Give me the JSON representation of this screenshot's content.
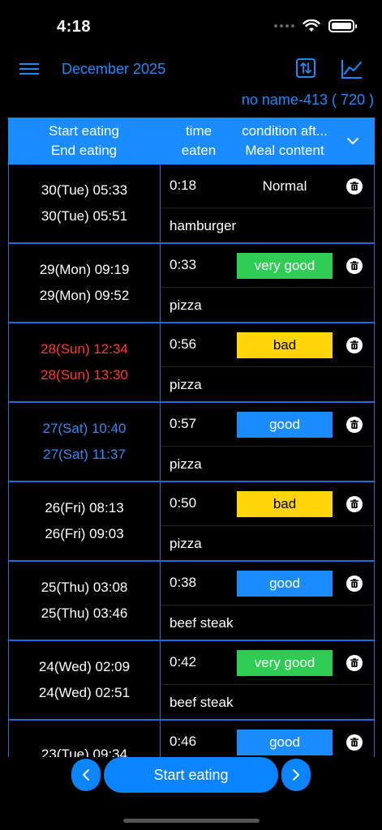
{
  "status": {
    "time": "4:18"
  },
  "nav": {
    "month": "December 2025"
  },
  "user": {
    "label": "no name-413  ( 720 )"
  },
  "header": {
    "start_eating": "Start eating",
    "end_eating": "End eating",
    "time": "time",
    "eaten": "eaten",
    "condition": "condition aft...",
    "meal_content": "Meal content"
  },
  "rows": [
    {
      "start": "30(Tue) 05:33",
      "end": "30(Tue) 05:51",
      "duration": "0:18",
      "condition": "Normal",
      "meal": "hamburger",
      "day_type": "weekday",
      "cond_type": "normal"
    },
    {
      "start": "29(Mon) 09:19",
      "end": "29(Mon) 09:52",
      "duration": "0:33",
      "condition": "very good",
      "meal": "pizza",
      "day_type": "weekday",
      "cond_type": "very-good"
    },
    {
      "start": "28(Sun) 12:34",
      "end": "28(Sun) 13:30",
      "duration": "0:56",
      "condition": "bad",
      "meal": "pizza",
      "day_type": "sun",
      "cond_type": "bad"
    },
    {
      "start": "27(Sat) 10:40",
      "end": "27(Sat) 11:37",
      "duration": "0:57",
      "condition": "good",
      "meal": "pizza",
      "day_type": "sat",
      "cond_type": "good"
    },
    {
      "start": "26(Fri) 08:13",
      "end": "26(Fri) 09:03",
      "duration": "0:50",
      "condition": "bad",
      "meal": "pizza",
      "day_type": "weekday",
      "cond_type": "bad"
    },
    {
      "start": "25(Thu) 03:08",
      "end": "25(Thu) 03:46",
      "duration": "0:38",
      "condition": "good",
      "meal": "beef steak",
      "day_type": "weekday",
      "cond_type": "good"
    },
    {
      "start": "24(Wed) 02:09",
      "end": "24(Wed) 02:51",
      "duration": "0:42",
      "condition": "very good",
      "meal": "beef steak",
      "day_type": "weekday",
      "cond_type": "very-good"
    },
    {
      "start": "23(Tue) 09:34",
      "end": "",
      "duration": "0:46",
      "condition": "good",
      "meal": "",
      "day_type": "weekday",
      "cond_type": "good"
    }
  ],
  "bottom": {
    "start_button": "Start eating"
  },
  "colors": {
    "accent": "#1a8cff",
    "very_good": "#2ecc52",
    "good": "#1a8cff",
    "bad": "#ffd60a",
    "sunday": "#ff3b30",
    "saturday": "#2f8cf0"
  },
  "icons": [
    "wifi-icon",
    "battery-icon",
    "menu-icon",
    "sort-icon",
    "chart-icon",
    "chevron-down-icon",
    "trash-icon",
    "chevron-left-icon",
    "chevron-right-icon"
  ]
}
